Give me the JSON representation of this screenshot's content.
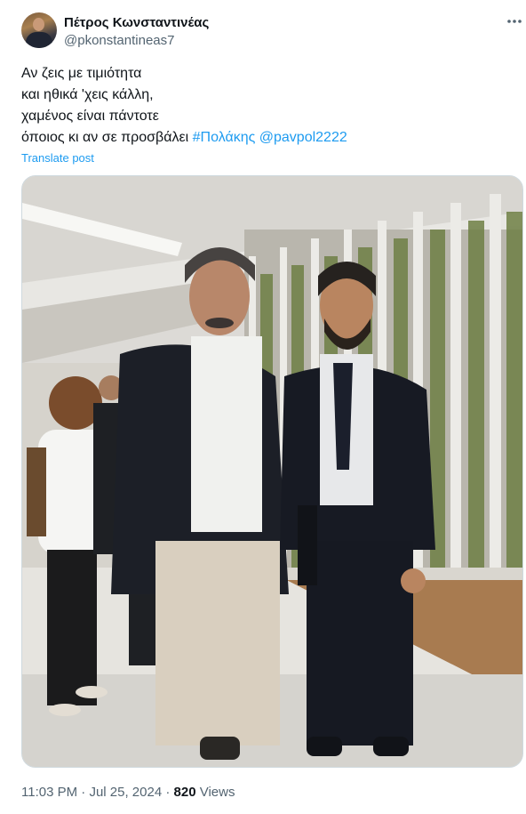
{
  "author": {
    "display_name": "Πέτρος Κωνσταντινέας",
    "handle": "@pkonstantineas7"
  },
  "tweet": {
    "lines": [
      "Αν ζεις με τιμιότητα",
      "και ηθικά 'χεις κάλλη,",
      "χαμένος είναι πάντοτε"
    ],
    "last_line_text": "όποιος κι αν σε προσβάλει ",
    "hashtag": "#Πολάκης",
    "mention": "@pavpol2222",
    "translate_label": "Translate post"
  },
  "meta": {
    "time": "11:03 PM",
    "separator": " · ",
    "date": "Jul 25, 2024",
    "views_count": "820",
    "views_label": " Views"
  },
  "icons": {
    "more": "more-horizontal-icon"
  },
  "colors": {
    "link": "#1d9bf0",
    "secondary_text": "#536471",
    "primary_text": "#0f1419",
    "border": "#cfd9de"
  }
}
